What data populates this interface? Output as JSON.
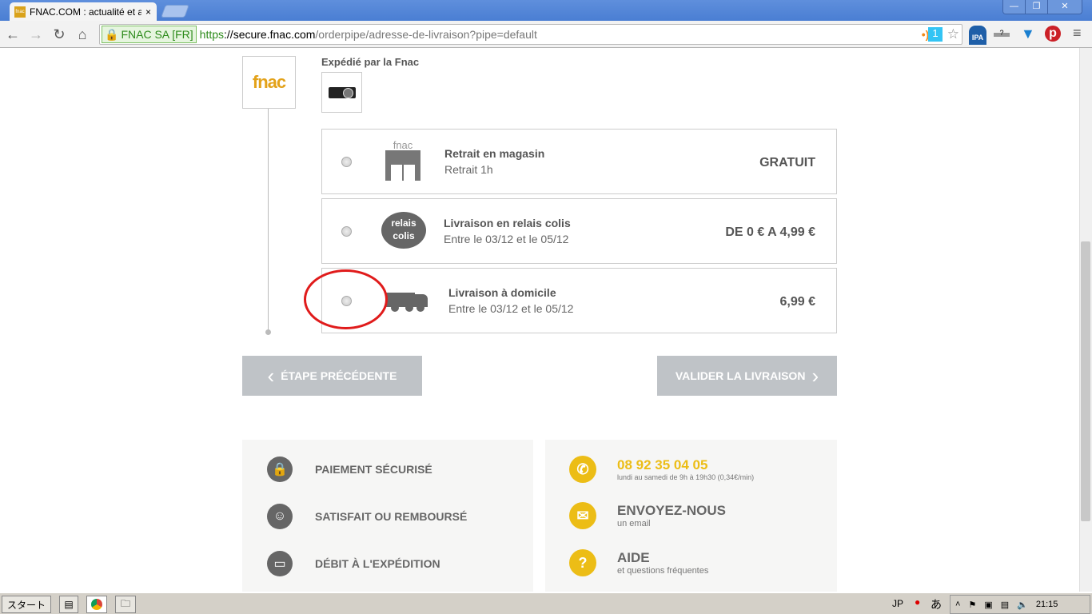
{
  "browser": {
    "tab_title": "FNAC.COM : actualité et a",
    "tab_close": "×",
    "favicon_text": "fnac",
    "ev_label": "FNAC SA [FR]",
    "url_scheme": "https",
    "url_host": "://secure.fnac.com",
    "url_path": "/orderpipe/adresse-de-livraison?pipe=default",
    "ext_badge": "1",
    "window_buttons": [
      "—",
      "❐",
      "✕"
    ]
  },
  "page": {
    "seller_logo": "fnac",
    "shipped_by": "Expédié par la Fnac",
    "options": [
      {
        "title": "Retrait en magasin",
        "subtitle": "Retrait 1h",
        "price": "GRATUIT",
        "logo_text": "fnac"
      },
      {
        "title": "Livraison en relais colis",
        "subtitle": "Entre le 03/12 et le 05/12",
        "price": "DE 0 € A 4,99 €",
        "logo_text": "relais colis"
      },
      {
        "title": "Livraison à domicile",
        "subtitle": "Entre le 03/12 et le 05/12",
        "price": "6,99 €"
      }
    ],
    "prev_button": "ÉTAPE PRÉCÉDENTE",
    "next_button": "VALIDER LA LIVRAISON",
    "guarantees": [
      "PAIEMENT SÉCURISÉ",
      "SATISFAIT OU REMBOURSÉ",
      "DÉBIT À L'EXPÉDITION"
    ],
    "contact": {
      "phone": "08 92 35 04 05",
      "phone_hours": "lundi au samedi de 9h à 19h30 (0,34€/min)",
      "email_title": "ENVOYEZ-NOUS",
      "email_sub": "un email",
      "help_title": "AIDE",
      "help_sub": "et questions fréquentes"
    }
  },
  "taskbar": {
    "start": "スタート",
    "lang": "JP",
    "ime": "あ",
    "clock": "21:15"
  },
  "colors": {
    "accent": "#ecbd16",
    "fnac": "#e3a21a",
    "button": "#bfc3c7",
    "annotation": "#e01b1b"
  }
}
